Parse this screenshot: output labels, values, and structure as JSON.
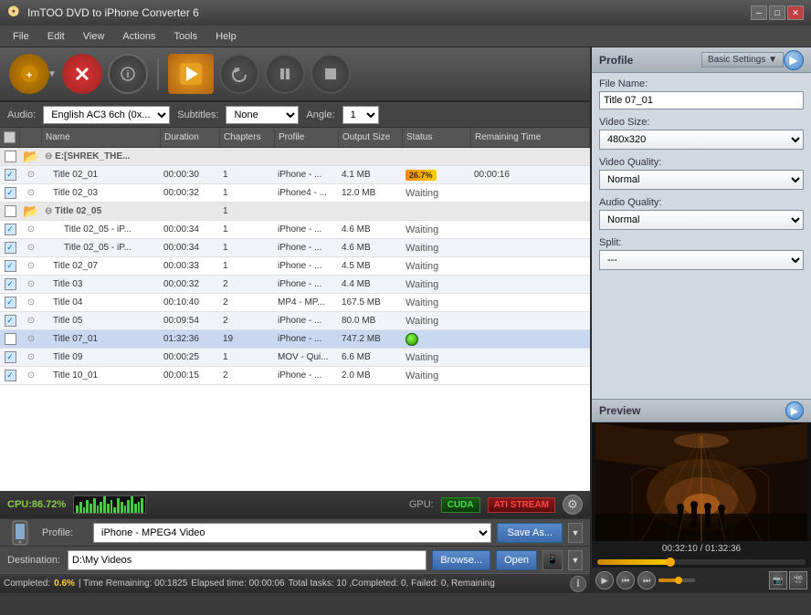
{
  "app": {
    "title": "ImTOO DVD to iPhone Converter 6",
    "icon": "📀"
  },
  "titlebar": {
    "minimize": "─",
    "maximize": "□",
    "close": "✕"
  },
  "menu": {
    "items": [
      "File",
      "Edit",
      "View",
      "Actions",
      "Tools",
      "Help"
    ]
  },
  "toolbar": {
    "add_label": "+",
    "stop_label": "✕",
    "info_label": "ℹ",
    "convert_label": "▶",
    "undo_label": "↺",
    "pause_label": "⏸",
    "stop2_label": "■"
  },
  "options": {
    "audio_label": "Audio:",
    "audio_value": "English AC3 6ch (0x...",
    "subtitles_label": "Subtitles:",
    "subtitles_value": "None",
    "angle_label": "Angle:",
    "angle_value": "1"
  },
  "columns": {
    "name": "Name",
    "duration": "Duration",
    "chapters": "Chapters",
    "profile": "Profile",
    "output_size": "Output Size",
    "status": "Status",
    "remaining": "Remaining Time"
  },
  "files": [
    {
      "id": "group1",
      "type": "group",
      "name": "E:[SHREK_THE...",
      "checked": false,
      "expanded": true
    },
    {
      "id": "title_02_01",
      "type": "file",
      "name": "Title 02_01",
      "duration": "00:00:30",
      "chapters": "1",
      "profile": "iPhone - ...",
      "output_size": "4.1 MB",
      "status": "progress",
      "status_value": "26.7%",
      "remaining": "00:00:16",
      "checked": true,
      "indent": 1
    },
    {
      "id": "title_02_03",
      "type": "file",
      "name": "Title 02_03",
      "duration": "00:00:32",
      "chapters": "1",
      "profile": "iPhone4 - ...",
      "output_size": "12.0 MB",
      "status": "Waiting",
      "remaining": "",
      "checked": true,
      "indent": 1
    },
    {
      "id": "group2",
      "type": "group",
      "name": "Title 02_05",
      "checked": false,
      "expanded": true,
      "chapters": "1"
    },
    {
      "id": "title_02_05a",
      "type": "file",
      "name": "Title 02_05 - iP...",
      "duration": "00:00:34",
      "chapters": "1",
      "profile": "iPhone - ...",
      "output_size": "4.6 MB",
      "status": "Waiting",
      "remaining": "",
      "checked": true,
      "indent": 2
    },
    {
      "id": "title_02_05b",
      "type": "file",
      "name": "Title 02_05 - iP...",
      "duration": "00:00:34",
      "chapters": "1",
      "profile": "iPhone - ...",
      "output_size": "4.6 MB",
      "status": "Waiting",
      "remaining": "",
      "checked": true,
      "indent": 2
    },
    {
      "id": "title_02_07",
      "type": "file",
      "name": "Title 02_07",
      "duration": "00:00:33",
      "chapters": "1",
      "profile": "iPhone - ...",
      "output_size": "4.5 MB",
      "status": "Waiting",
      "remaining": "",
      "checked": true,
      "indent": 1
    },
    {
      "id": "title_03",
      "type": "file",
      "name": "Title 03",
      "duration": "00:00:32",
      "chapters": "2",
      "profile": "iPhone - ...",
      "output_size": "4.4 MB",
      "status": "Waiting",
      "remaining": "",
      "checked": true,
      "indent": 1
    },
    {
      "id": "title_04",
      "type": "file",
      "name": "Title 04",
      "duration": "00:10:40",
      "chapters": "2",
      "profile": "MP4 - MP...",
      "output_size": "167.5 MB",
      "status": "Waiting",
      "remaining": "",
      "checked": true,
      "indent": 1
    },
    {
      "id": "title_05",
      "type": "file",
      "name": "Title 05",
      "duration": "00:09:54",
      "chapters": "2",
      "profile": "iPhone - ...",
      "output_size": "80.0 MB",
      "status": "Waiting",
      "remaining": "",
      "checked": true,
      "indent": 1
    },
    {
      "id": "title_07_01",
      "type": "file",
      "name": "Title 07_01",
      "duration": "01:32:36",
      "chapters": "19",
      "profile": "iPhone - ...",
      "output_size": "747.2 MB",
      "status": "green_btn",
      "remaining": "",
      "checked": false,
      "selected": true,
      "indent": 1
    },
    {
      "id": "title_09",
      "type": "file",
      "name": "Title 09",
      "duration": "00:00:25",
      "chapters": "1",
      "profile": "MOV - Qui...",
      "output_size": "6.6 MB",
      "status": "Waiting",
      "remaining": "",
      "checked": true,
      "indent": 1
    },
    {
      "id": "title_10_01",
      "type": "file",
      "name": "Title 10_01",
      "duration": "00:00:15",
      "chapters": "2",
      "profile": "iPhone - ...",
      "output_size": "2.0 MB",
      "status": "Waiting",
      "remaining": "",
      "checked": true,
      "indent": 1
    }
  ],
  "cpu": {
    "label": "CPU:86.72%",
    "gpu_label": "GPU:",
    "cuda_label": "CUDA",
    "ati_label": "ATI STREAM",
    "bars": [
      8,
      12,
      6,
      14,
      10,
      16,
      8,
      12,
      18,
      10,
      14,
      6,
      16,
      12,
      8,
      14,
      18,
      10,
      12,
      16
    ]
  },
  "profile_bar": {
    "label": "Profile:",
    "value": "iPhone - MPEG4 Video",
    "save_as": "Save As...",
    "dropdown": "▼"
  },
  "dest_bar": {
    "label": "Destination:",
    "value": "D:\\My Videos",
    "browse": "Browse...",
    "open": "Open",
    "dropdown": "▼"
  },
  "status_bar": {
    "completed_label": "Completed:",
    "completed_pct": "0.6%",
    "time_remaining": "| Time Remaining: 00:1825",
    "elapsed": "Elapsed time: 00:00:06",
    "total": "Total tasks: 10 ,Completed: 0, Failed: 0, Remaining"
  },
  "right_panel": {
    "title": "Profile",
    "settings_btn": "Basic Settings ▼",
    "fields": {
      "file_name_label": "File Name:",
      "file_name_value": "Title 07_01",
      "video_size_label": "Video Size:",
      "video_size_value": "480x320",
      "video_quality_label": "Video Quality:",
      "video_quality_value": "Normal",
      "audio_quality_label": "Audio Quality:",
      "audio_quality_value": "Normal",
      "split_label": "Split:"
    }
  },
  "preview": {
    "title": "Preview",
    "time_current": "00:32:10",
    "time_total": "01:32:36",
    "time_display": "00:32:10 / 01:32:36",
    "progress_pct": 35,
    "controls": {
      "play": "▶",
      "rewind": "⏮",
      "forward": "⏭",
      "vol_icon": "🔊"
    }
  }
}
